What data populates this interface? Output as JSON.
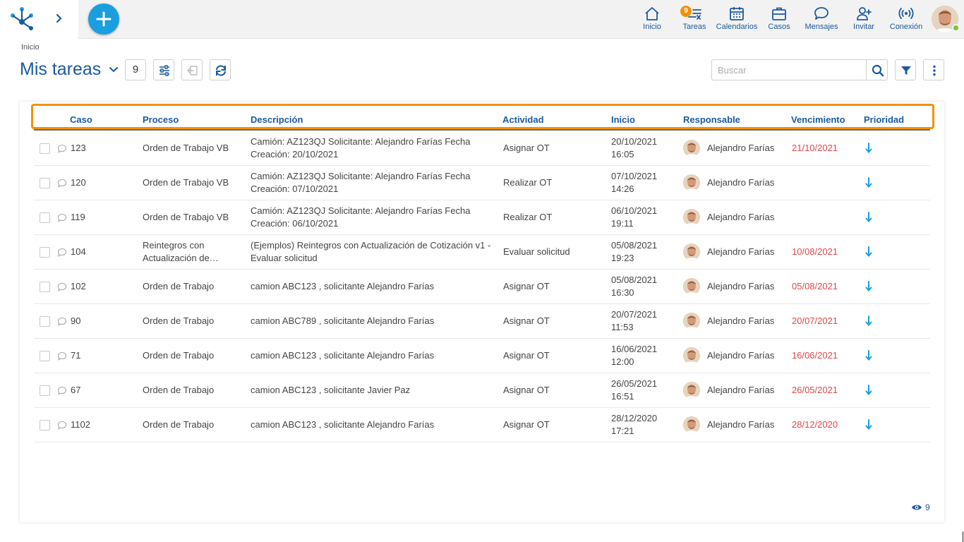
{
  "nav": {
    "items": [
      {
        "label": "Inicio",
        "icon": "home-icon"
      },
      {
        "label": "Tareas",
        "icon": "tasks-icon",
        "badge": "9"
      },
      {
        "label": "Calendarios",
        "icon": "calendar-icon"
      },
      {
        "label": "Casos",
        "icon": "briefcase-icon"
      },
      {
        "label": "Mensajes",
        "icon": "chat-icon"
      },
      {
        "label": "Invitar",
        "icon": "add-user-icon"
      },
      {
        "label": "Conexión",
        "icon": "broadcast-icon"
      }
    ]
  },
  "breadcrumb": "Inicio",
  "page": {
    "title": "Mis tareas",
    "count": "9"
  },
  "search": {
    "placeholder": "Buscar"
  },
  "columns": [
    "Caso",
    "Proceso",
    "Descripción",
    "Actividad",
    "Inicio",
    "Responsable",
    "Vencimiento",
    "Prioridad"
  ],
  "rows": [
    {
      "caso": "123",
      "proceso": [
        "Orden de Trabajo VB"
      ],
      "descripcion": [
        "Camión: AZ123QJ Solicitante: Alejandro Farías Fecha",
        "Creación: 20/10/2021"
      ],
      "actividad": "Asignar OT",
      "inicio": [
        "20/10/2021",
        "16:05"
      ],
      "responsable": "Alejandro Farías",
      "vencimiento": "21/10/2021"
    },
    {
      "caso": "120",
      "proceso": [
        "Orden de Trabajo VB"
      ],
      "descripcion": [
        "Camión: AZ123QJ Solicitante: Alejandro Farías Fecha",
        "Creación: 07/10/2021"
      ],
      "actividad": "Realizar OT",
      "inicio": [
        "07/10/2021",
        "14:26"
      ],
      "responsable": "Alejandro Farías",
      "vencimiento": ""
    },
    {
      "caso": "119",
      "proceso": [
        "Orden de Trabajo VB"
      ],
      "descripcion": [
        "Camión: AZ123QJ Solicitante: Alejandro Farías Fecha",
        "Creación: 06/10/2021"
      ],
      "actividad": "Realizar OT",
      "inicio": [
        "06/10/2021",
        "19:11"
      ],
      "responsable": "Alejandro Farías",
      "vencimiento": ""
    },
    {
      "caso": "104",
      "proceso": [
        "Reintegros con",
        "Actualización de…"
      ],
      "descripcion": [
        "(Ejemplos) Reintegros con Actualización de Cotización v1 -",
        "Evaluar solicitud"
      ],
      "actividad": "Evaluar solicitud",
      "inicio": [
        "05/08/2021",
        "19:23"
      ],
      "responsable": "Alejandro Farías",
      "vencimiento": "10/08/2021"
    },
    {
      "caso": "102",
      "proceso": [
        "Orden de Trabajo"
      ],
      "descripcion": [
        "camion ABC123 , solicitante Alejandro Farías"
      ],
      "actividad": "Asignar OT",
      "inicio": [
        "05/08/2021",
        "16:30"
      ],
      "responsable": "Alejandro Farías",
      "vencimiento": "05/08/2021"
    },
    {
      "caso": "90",
      "proceso": [
        "Orden de Trabajo"
      ],
      "descripcion": [
        "camion ABC789 , solicitante Alejandro Farías"
      ],
      "actividad": "Asignar OT",
      "inicio": [
        "20/07/2021",
        "11:53"
      ],
      "responsable": "Alejandro Farías",
      "vencimiento": "20/07/2021"
    },
    {
      "caso": "71",
      "proceso": [
        "Orden de Trabajo"
      ],
      "descripcion": [
        "camion ABC123 , solicitante Alejandro Farías"
      ],
      "actividad": "Asignar OT",
      "inicio": [
        "16/06/2021",
        "12:00"
      ],
      "responsable": "Alejandro Farías",
      "vencimiento": "16/06/2021"
    },
    {
      "caso": "67",
      "proceso": [
        "Orden de Trabajo"
      ],
      "descripcion": [
        "camion ABC123 , solicitante Javier Paz"
      ],
      "actividad": "Asignar OT",
      "inicio": [
        "26/05/2021",
        "16:51"
      ],
      "responsable": "Alejandro Farías",
      "vencimiento": "26/05/2021"
    },
    {
      "caso": "1102",
      "proceso": [
        "Orden de Trabajo"
      ],
      "descripcion": [
        "camion ABC123 , solicitante Alejandro Farías"
      ],
      "actividad": "Asignar OT",
      "inicio": [
        "28/12/2020",
        "17:21"
      ],
      "responsable": "Alejandro Farías",
      "vencimiento": "28/12/2020"
    }
  ],
  "footer": {
    "visible_count": "9"
  },
  "colors": {
    "primary": "#1b5aa0",
    "accent": "#1a9ee0",
    "highlight": "#f39200",
    "overdue": "#e0474c"
  }
}
